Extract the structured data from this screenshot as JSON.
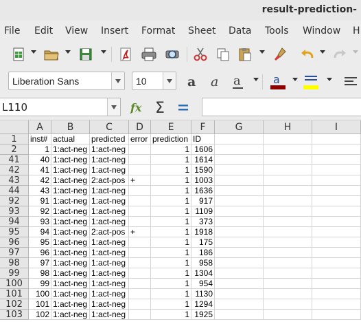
{
  "window": {
    "title": "result-prediction-"
  },
  "menu": [
    "File",
    "Edit",
    "View",
    "Insert",
    "Format",
    "Sheet",
    "Data",
    "Tools",
    "Window",
    "H"
  ],
  "format": {
    "font_name": "Liberation Sans",
    "font_size": "10"
  },
  "formula_bar": {
    "cell_ref": "L110",
    "content": ""
  },
  "colors": {
    "font_color": "#8b0000",
    "highlight_color": "#ffff00",
    "cut_icon": "#cc3333",
    "accent": "#2a6db5"
  },
  "sheet": {
    "columns": [
      "A",
      "B",
      "C",
      "D",
      "E",
      "F",
      "G",
      "H",
      "I"
    ],
    "rows": [
      {
        "num": "1",
        "cells": [
          "inst#",
          "actual",
          "predicted",
          "error",
          "prediction",
          "ID"
        ]
      },
      {
        "num": "2",
        "cells": [
          "1",
          "1:act-neg",
          "1:act-neg",
          "",
          "1",
          "1606"
        ]
      },
      {
        "num": "41",
        "cells": [
          "40",
          "1:act-neg",
          "1:act-neg",
          "",
          "1",
          "1614"
        ]
      },
      {
        "num": "42",
        "cells": [
          "41",
          "1:act-neg",
          "1:act-neg",
          "",
          "1",
          "1590"
        ]
      },
      {
        "num": "43",
        "cells": [
          "42",
          "1:act-neg",
          "2:act-pos",
          "+",
          "1",
          "1003"
        ]
      },
      {
        "num": "44",
        "cells": [
          "43",
          "1:act-neg",
          "1:act-neg",
          "",
          "1",
          "1636"
        ]
      },
      {
        "num": "92",
        "cells": [
          "91",
          "1:act-neg",
          "1:act-neg",
          "",
          "1",
          "917"
        ]
      },
      {
        "num": "93",
        "cells": [
          "92",
          "1:act-neg",
          "1:act-neg",
          "",
          "1",
          "1109"
        ]
      },
      {
        "num": "94",
        "cells": [
          "93",
          "1:act-neg",
          "1:act-neg",
          "",
          "1",
          "373"
        ]
      },
      {
        "num": "95",
        "cells": [
          "94",
          "1:act-neg",
          "2:act-pos",
          "+",
          "1",
          "1918"
        ]
      },
      {
        "num": "96",
        "cells": [
          "95",
          "1:act-neg",
          "1:act-neg",
          "",
          "1",
          "175"
        ]
      },
      {
        "num": "97",
        "cells": [
          "96",
          "1:act-neg",
          "1:act-neg",
          "",
          "1",
          "186"
        ]
      },
      {
        "num": "98",
        "cells": [
          "97",
          "1:act-neg",
          "1:act-neg",
          "",
          "1",
          "958"
        ]
      },
      {
        "num": "99",
        "cells": [
          "98",
          "1:act-neg",
          "1:act-neg",
          "",
          "1",
          "1304"
        ]
      },
      {
        "num": "100",
        "cells": [
          "99",
          "1:act-neg",
          "1:act-neg",
          "",
          "1",
          "954"
        ]
      },
      {
        "num": "101",
        "cells": [
          "100",
          "1:act-neg",
          "1:act-neg",
          "",
          "1",
          "1130"
        ]
      },
      {
        "num": "102",
        "cells": [
          "101",
          "1:act-neg",
          "1:act-neg",
          "",
          "1",
          "1294"
        ]
      },
      {
        "num": "103",
        "cells": [
          "102",
          "1:act-neg",
          "1:act-neg",
          "",
          "1",
          "1925"
        ]
      }
    ]
  }
}
